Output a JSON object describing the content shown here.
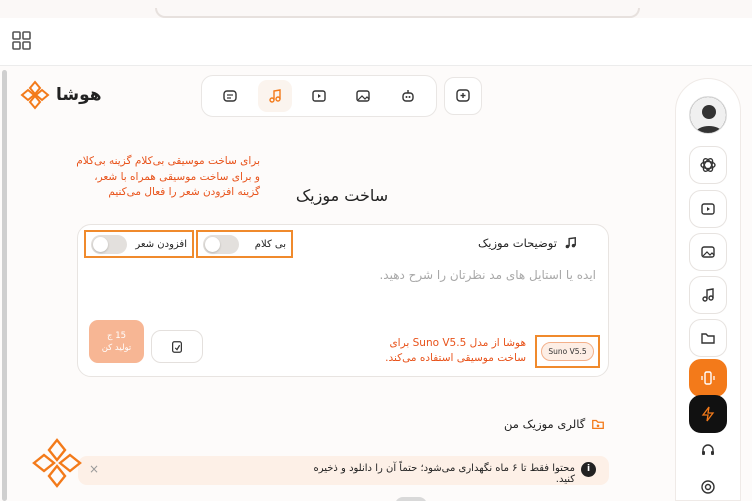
{
  "app": {
    "logo_text": "هوشا"
  },
  "page": {
    "title": "ساخت موزیک"
  },
  "annotations": {
    "top_line1": "برای ساخت موسیقی بی‌کلام گزینه بی‌کلام",
    "top_line2": "و برای ساخت موسیقی همراه با شعر،",
    "top_line3": "گزینه افزودن شعر را فعال می‌کنیم",
    "suno_line1": "هوشا از مدل Suno V5.5 برای",
    "suno_line2": "ساخت موسیقی استفاده می‌کند."
  },
  "card": {
    "label": "توضیحات موزیک",
    "instrumental_label": "بی کلام",
    "add_lyrics_label": "افزودن شعر",
    "prompt_placeholder": "ایده یا استایل های مد نظرتان را شرح دهید.",
    "generate_cost": "15 ج",
    "generate_label": "تولید کن",
    "model_badge": "Suno V5.5"
  },
  "gallery": {
    "title": "گالری موزیک من",
    "notice": "محتوا فقط تا ۶ ماه نگهداری می‌شود؛ حتماً آن را دانلود و ذخیره کنید.",
    "info_glyph": "i",
    "close_glyph": "×"
  },
  "toolbar": {
    "items": [
      "chat-icon",
      "music-icon",
      "video-icon",
      "image-icon",
      "robot-icon"
    ],
    "active": "music-icon"
  },
  "sidebar": {
    "items": [
      "openai-icon",
      "video-icon",
      "image-icon",
      "music-icon",
      "folder-icon",
      "mobile-icon",
      "flash-icon",
      "headset-icon",
      "support-icon"
    ]
  },
  "colors": {
    "accent": "#f37a1a",
    "annotation": "#e8521a"
  }
}
